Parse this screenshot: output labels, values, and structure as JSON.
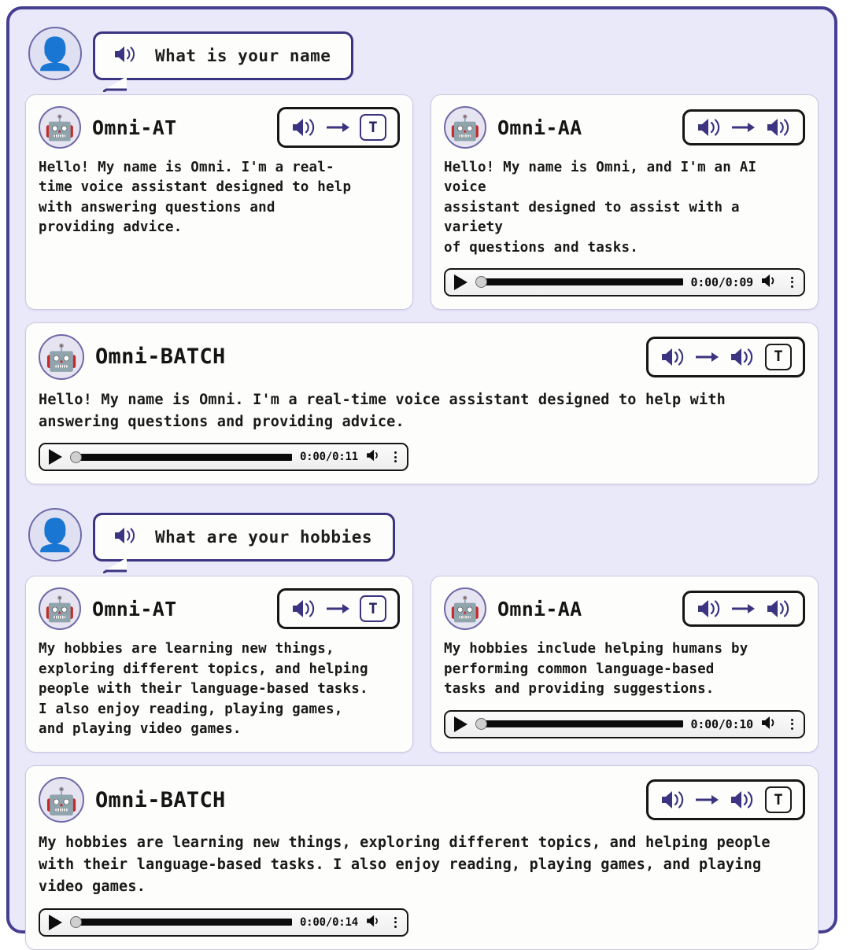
{
  "theme": {
    "frame_border": "#463f91",
    "frame_bg": "#eae9fa",
    "card_bg": "#fdfdfb",
    "accent_indigo": "#3b3480",
    "text": "#191919"
  },
  "turns": [
    {
      "user": {
        "avatar_icon": "person-avatar",
        "speaker_icon": "speaker-icon",
        "query": "What is your name"
      },
      "responses": [
        {
          "id": "omni-at",
          "avatar_icon": "robot-avatar",
          "title": "Omni-AT",
          "badge": {
            "icons": [
              "speaker-icon",
              "arrow-right-icon",
              "text-t-box"
            ],
            "t_label": "T"
          },
          "text": "Hello! My name is Omni. I'm a real-\ntime voice assistant designed to help\nwith answering questions and\nproviding advice.",
          "player": null
        },
        {
          "id": "omni-aa",
          "avatar_icon": "robot-avatar",
          "title": "Omni-AA",
          "badge": {
            "icons": [
              "speaker-icon",
              "arrow-right-icon",
              "speaker-icon"
            ],
            "t_label": ""
          },
          "text": "Hello! My name is Omni, and I'm an AI voice\nassistant designed to assist with a variety\nof questions and tasks.",
          "player": {
            "play_icon": "play-icon",
            "time": "0:00/0:09",
            "volume_icon": "speaker-icon",
            "menu_icon": "more-vertical-icon"
          }
        }
      ],
      "batch": {
        "id": "omni-batch",
        "avatar_icon": "robot-avatar",
        "title": "Omni-BATCH",
        "badge": {
          "icons": [
            "speaker-icon",
            "arrow-right-icon",
            "speaker-icon",
            "text-t-box"
          ],
          "t_label": "T"
        },
        "text": "Hello! My name is Omni. I'm a real-time voice assistant designed to help with\nanswering questions and providing advice.",
        "player": {
          "play_icon": "play-icon",
          "time": "0:00/0:11",
          "volume_icon": "speaker-icon",
          "menu_icon": "more-vertical-icon"
        }
      }
    },
    {
      "user": {
        "avatar_icon": "person-avatar",
        "speaker_icon": "speaker-icon",
        "query": "What are your hobbies"
      },
      "responses": [
        {
          "id": "omni-at",
          "avatar_icon": "robot-avatar",
          "title": "Omni-AT",
          "badge": {
            "icons": [
              "speaker-icon",
              "arrow-right-icon",
              "text-t-box"
            ],
            "t_label": "T"
          },
          "text": " My hobbies are learning new things,\nexploring different topics, and helping\npeople with their language-based tasks.\nI also enjoy reading, playing games,\nand playing video games.",
          "player": null
        },
        {
          "id": "omni-aa",
          "avatar_icon": "robot-avatar",
          "title": "Omni-AA",
          "badge": {
            "icons": [
              "speaker-icon",
              "arrow-right-icon",
              "speaker-icon"
            ],
            "t_label": ""
          },
          "text": "My hobbies include helping humans by\nperforming common language-based\ntasks and providing suggestions.",
          "player": {
            "play_icon": "play-icon",
            "time": "0:00/0:10",
            "volume_icon": "speaker-icon",
            "menu_icon": "more-vertical-icon"
          }
        }
      ],
      "batch": {
        "id": "omni-batch",
        "avatar_icon": "robot-avatar",
        "title": "Omni-BATCH",
        "badge": {
          "icons": [
            "speaker-icon",
            "arrow-right-icon",
            "speaker-icon",
            "text-t-box"
          ],
          "t_label": "T"
        },
        "text": "My hobbies are learning new things, exploring different topics, and helping people\nwith their language-based tasks. I also enjoy reading, playing games, and playing\nvideo games.",
        "player": {
          "play_icon": "play-icon",
          "time": "0:00/0:14",
          "volume_icon": "speaker-icon",
          "menu_icon": "more-vertical-icon"
        }
      }
    }
  ]
}
